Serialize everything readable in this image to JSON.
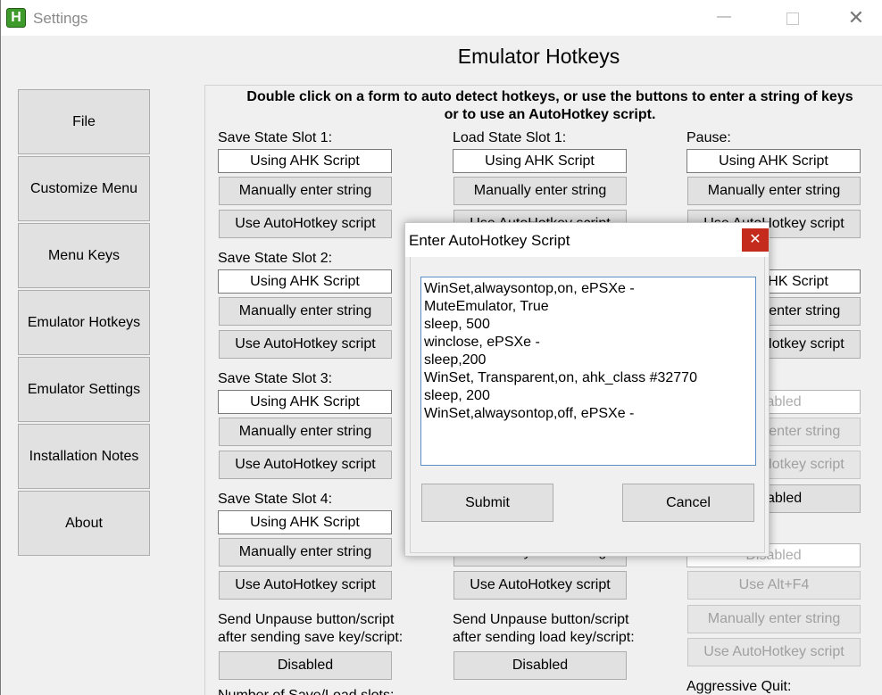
{
  "window": {
    "title": "Settings",
    "app_icon_letter": "H",
    "minimize_glyph": "—",
    "close_glyph": "✕"
  },
  "page": {
    "title": "Emulator Hotkeys",
    "instructions_line1": "Double click on a form to auto detect hotkeys, or use the buttons to enter a string of keys",
    "instructions_line2": "or to use an AutoHotkey script."
  },
  "sidebar": {
    "items": [
      {
        "label": "File"
      },
      {
        "label": "Customize Menu"
      },
      {
        "label": "Menu Keys"
      },
      {
        "label": "Emulator Hotkeys"
      },
      {
        "label": "Emulator Settings"
      },
      {
        "label": "Installation Notes"
      },
      {
        "label": "About"
      }
    ]
  },
  "col1": {
    "slots": [
      {
        "label": "Save State Slot 1:",
        "field": "Using AHK Script",
        "manual": "Manually enter string",
        "ahk": "Use AutoHotkey script"
      },
      {
        "label": "Save State Slot 2:",
        "field": "Using AHK Script",
        "manual": "Manually enter string",
        "ahk": "Use AutoHotkey script"
      },
      {
        "label": "Save State Slot 3:",
        "field": "Using AHK Script",
        "manual": "Manually enter string",
        "ahk": "Use AutoHotkey script"
      },
      {
        "label": "Save State Slot 4:",
        "field": "Using AHK Script",
        "manual": "Manually enter string",
        "ahk": "Use AutoHotkey script"
      }
    ],
    "unpause_label_line1": "Send Unpause button/script",
    "unpause_label_line2": "after sending save key/script:",
    "unpause_button": "Disabled",
    "bottom_cut_label": "Number of Save/Load slots:"
  },
  "col2": {
    "slot1": {
      "label": "Load State Slot 1:",
      "field": "Using AHK Script",
      "manual": "Manually enter string",
      "ahk": "Use AutoHotkey script"
    },
    "slot2_visible": {
      "manual": "Manually enter string",
      "ahk": "Use AutoHotkey script"
    },
    "unpause_label_line1": "Send Unpause button/script",
    "unpause_label_line2": "after sending load key/script:",
    "unpause_button": "Disabled"
  },
  "col3": {
    "pause": {
      "label": "Pause:",
      "field": "Using AHK Script",
      "manual": "Manually enter string",
      "ahk": "Use AutoHotkey script"
    },
    "block2": {
      "field": "Using AHK Script",
      "manual": "Manually enter string",
      "ahk": "Use AutoHotkey script"
    },
    "block3": {
      "field": "Disabled",
      "manual": "Manually enter string",
      "ahk": "Use AutoHotkey script",
      "toggle": "Disabled"
    },
    "block4": {
      "field": "Disabled",
      "alt_f4": "Use Alt+F4",
      "manual": "Manually enter string",
      "ahk": "Use AutoHotkey script"
    },
    "aggressive_quit_label": "Aggressive Quit:"
  },
  "dialog": {
    "title": "Enter AutoHotkey Script",
    "close_glyph": "✕",
    "script_lines": [
      "WinSet,alwaysontop,on, ePSXe -",
      "MuteEmulator, True",
      "sleep, 500",
      "winclose, ePSXe -",
      "sleep,200",
      "WinSet, Transparent,on, ahk_class #32770",
      "sleep, 200",
      "WinSet,alwaysontop,off, ePSXe -"
    ],
    "submit_label": "Submit",
    "cancel_label": "Cancel"
  },
  "colors": {
    "dialog_close_bg": "#c42b1c",
    "app_icon_bg": "#3e9a2a",
    "button_bg": "#e1e1e1",
    "window_bg": "#f0f0f0"
  }
}
